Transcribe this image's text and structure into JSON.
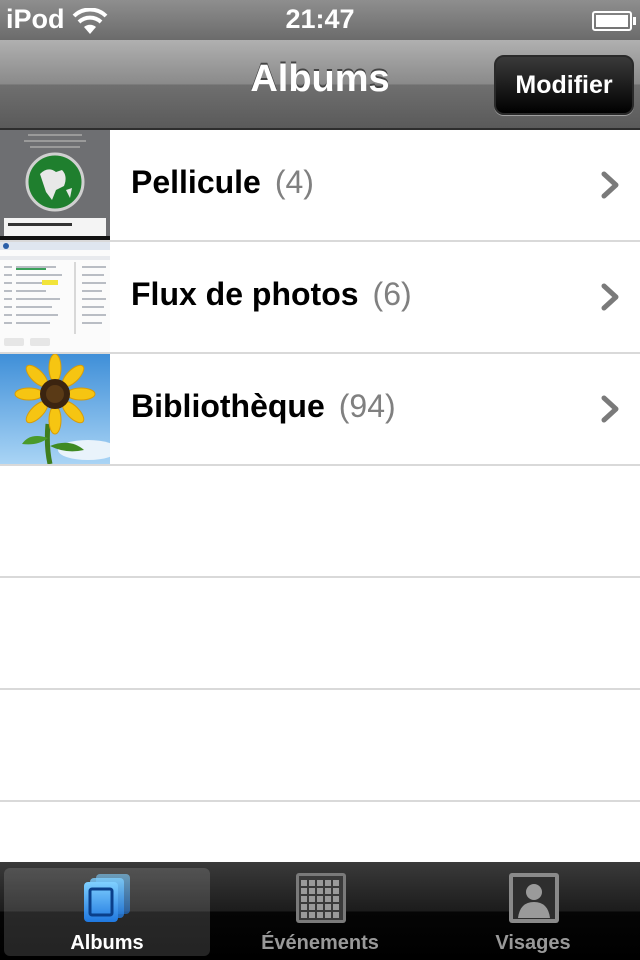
{
  "status_bar": {
    "carrier": "iPod",
    "time": "21:47"
  },
  "nav_bar": {
    "title": "Albums",
    "edit_label": "Modifier"
  },
  "albums": [
    {
      "title": "Pellicule",
      "count": "(4)",
      "thumbnail": "find-my-ipod-screenshot"
    },
    {
      "title": "Flux de photos",
      "count": "(6)",
      "thumbnail": "mail-list-screenshot"
    },
    {
      "title": "Bibliothèque",
      "count": "(94)",
      "thumbnail": "sunflower-photo"
    }
  ],
  "tabs": [
    {
      "label": "Albums",
      "icon": "albums-icon",
      "active": true
    },
    {
      "label": "Événements",
      "icon": "calendar-grid-icon",
      "active": false
    },
    {
      "label": "Visages",
      "icon": "portrait-icon",
      "active": false
    }
  ],
  "colors": {
    "accent_blue": "#3aa0ff",
    "count_gray": "#808080",
    "separator": "#d9d9d9"
  }
}
